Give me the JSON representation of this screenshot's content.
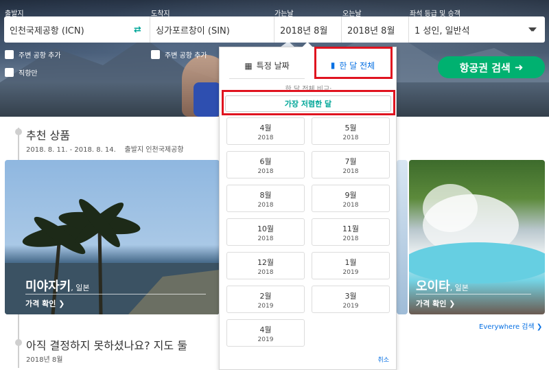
{
  "labels": {
    "origin": "출발지",
    "destination": "도착지",
    "depart": "가는날",
    "return": "오는날",
    "cabin": "좌석 등급 및 승객"
  },
  "fields": {
    "origin": "인천국제공항 (ICN)",
    "destination": "싱가포르창이 (SIN)",
    "depart": "2018년 8월",
    "return": "2018년 8월",
    "cabin": "1 성인, 일반석"
  },
  "checkboxes": {
    "nearby_origin": "주변 공항 추가",
    "nearby_destination": "주변 공항 추가",
    "direct": "직항만"
  },
  "search_button": "항공권 검색",
  "section1": {
    "title": "추천 상품",
    "subtitle": "2018. 8. 11. - 2018. 8. 14.    출발지 인천국제공항"
  },
  "cards": [
    {
      "city": "미야자키",
      "country": ", 일본",
      "price": "가격 확인"
    },
    {
      "city": "오이타",
      "country": ", 일본",
      "price": "가격 확인"
    }
  ],
  "everywhere": "Everywhere 검색",
  "section2": {
    "title": "아직 결정하지 못하셨나요? 지도 둘",
    "subtitle": "2018년 8월"
  },
  "popup": {
    "tab_date": "특정 날짜",
    "tab_month": "한 달 전체",
    "compare_label": "한 달 전체 비교:",
    "cheapest": "가장 저렴한 달",
    "months": [
      {
        "m": "4월",
        "y": "2018"
      },
      {
        "m": "5월",
        "y": "2018"
      },
      {
        "m": "6월",
        "y": "2018"
      },
      {
        "m": "7월",
        "y": "2018"
      },
      {
        "m": "8월",
        "y": "2018"
      },
      {
        "m": "9월",
        "y": "2018"
      },
      {
        "m": "10월",
        "y": "2018"
      },
      {
        "m": "11월",
        "y": "2018"
      },
      {
        "m": "12월",
        "y": "2018"
      },
      {
        "m": "1월",
        "y": "2019"
      },
      {
        "m": "2월",
        "y": "2019"
      },
      {
        "m": "3월",
        "y": "2019"
      },
      {
        "m": "4월",
        "y": "2019"
      }
    ],
    "cancel": "취소"
  },
  "colors": {
    "accent_green": "#00b170",
    "link_blue": "#0770e3",
    "highlight_red": "#e0131f",
    "teal": "#00a698"
  },
  "icons": [
    "swap-icon",
    "calendar-icon",
    "bar-chart-icon",
    "arrow-right-icon",
    "chevron-right-icon",
    "caret-down-icon"
  ]
}
